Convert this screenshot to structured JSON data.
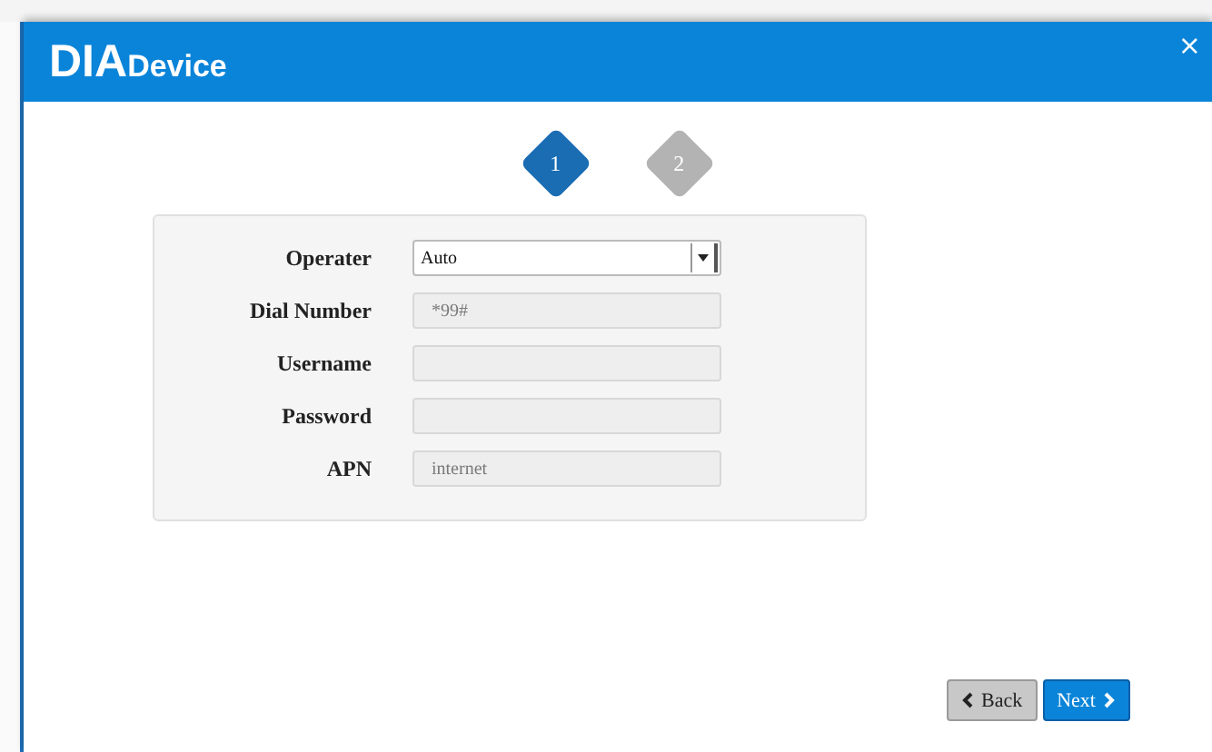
{
  "dialog": {
    "logo_main": "DIA",
    "logo_sub": "Device",
    "close": "×"
  },
  "steps": [
    {
      "label": "1",
      "selected": true
    },
    {
      "label": "2",
      "selected": false
    }
  ],
  "form": [
    {
      "kind": "select",
      "label": "Operater",
      "value": "Auto",
      "disabled": false
    },
    {
      "kind": "text",
      "label": "Dial Number",
      "value": "*99#",
      "disabled": true
    },
    {
      "kind": "text",
      "label": "Username",
      "disabled": true
    },
    {
      "kind": "text",
      "label": "Password",
      "disabled": true
    },
    {
      "kind": "text",
      "label": "APN",
      "value": "internet",
      "disabled": true
    }
  ],
  "buttons": [
    {
      "kind": "back",
      "label": "Back"
    },
    {
      "kind": "next",
      "label": "Next"
    }
  ]
}
